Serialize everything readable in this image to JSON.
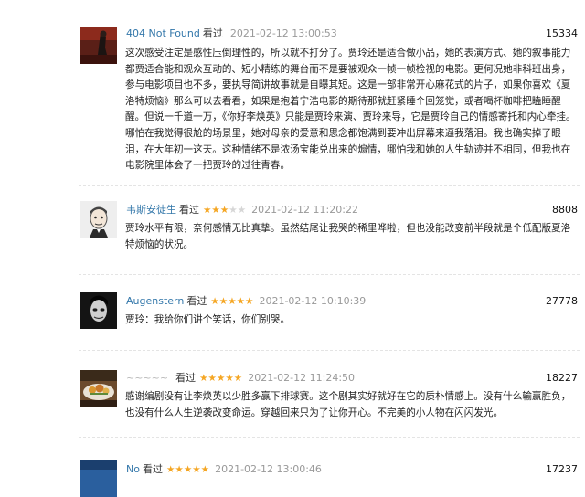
{
  "reviews": [
    {
      "user": "404 Not Found",
      "watched": "看过",
      "rating": 0,
      "date": "2021-02-12 13:00:53",
      "votes": "15334",
      "avatar": "poster-figure",
      "text": "这次感受注定是感性压倒理性的，所以就不打分了。贾玲还是适合做小品，她的表演方式、她的叙事能力都贾适合能和观众互动的、短小精练的舞台而不是要被观众一帧一帧检视的电影。更何况她非科班出身，参与电影项目也不多，要执导简讲故事就是自曝其短。这是一部非常开心麻花式的片子，如果你喜欢《夏洛特烦恼》那么可以去看看，如果是抱着宁浩电影的期待那就赶紧睡个回笼觉，或者喝杯咖啡把瞌睡醒醒。但说一千道一万，《你好李焕英》只能是贾玲来演、贾玲来导，它是贾玲自己的情感寄托和内心牵挂。哪怕在我觉得很尬的场景里，她对母亲的爱意和思念都饱满到要冲出屏幕来逼我落泪。我也确实掉了眼泪，在大年初一这天。这种情绪不是浓汤宝能兑出来的煽情，哪怕我和她的人生轨迹并不相同，但我也在电影院里体会了一把贾玲的过往青春。"
    },
    {
      "user": "韦斯安徒生",
      "watched": "看过",
      "rating": 3,
      "date": "2021-02-12 11:20:22",
      "votes": "8808",
      "avatar": "cartoon-face",
      "text": "贾玲水平有限，奈何感情无比真挚。虽然结尾让我哭的稀里哗啦，但也没能改变前半段就是个低配版夏洛特烦恼的状况。"
    },
    {
      "user": "Augenstern",
      "watched": "看过",
      "rating": 5,
      "date": "2021-02-12 10:10:39",
      "votes": "27778",
      "avatar": "dark-face",
      "text": "贾玲：我给你们讲个笑话，你们别哭。"
    },
    {
      "user": "~~~~~",
      "watched": "看过",
      "rating": 5,
      "date": "2021-02-12 11:24:50",
      "votes": "18227",
      "avatar": "food-photo",
      "text": "感谢编剧没有让李焕英以少胜多赢下排球赛。这个剧其实好就好在它的质朴情感上。没有什么输赢胜负，也没有什么人生逆袭改变命运。穿越回来只为了让你开心。不完美的小人物在闪闪发光。"
    },
    {
      "user": "No",
      "watched": "看过",
      "rating": 5,
      "date": "2021-02-12 13:00:46",
      "votes": "17237",
      "avatar": "blue-photo",
      "text": ""
    }
  ],
  "colors": {
    "link": "#3377aa",
    "star": "#f5a623",
    "date": "#999999"
  }
}
